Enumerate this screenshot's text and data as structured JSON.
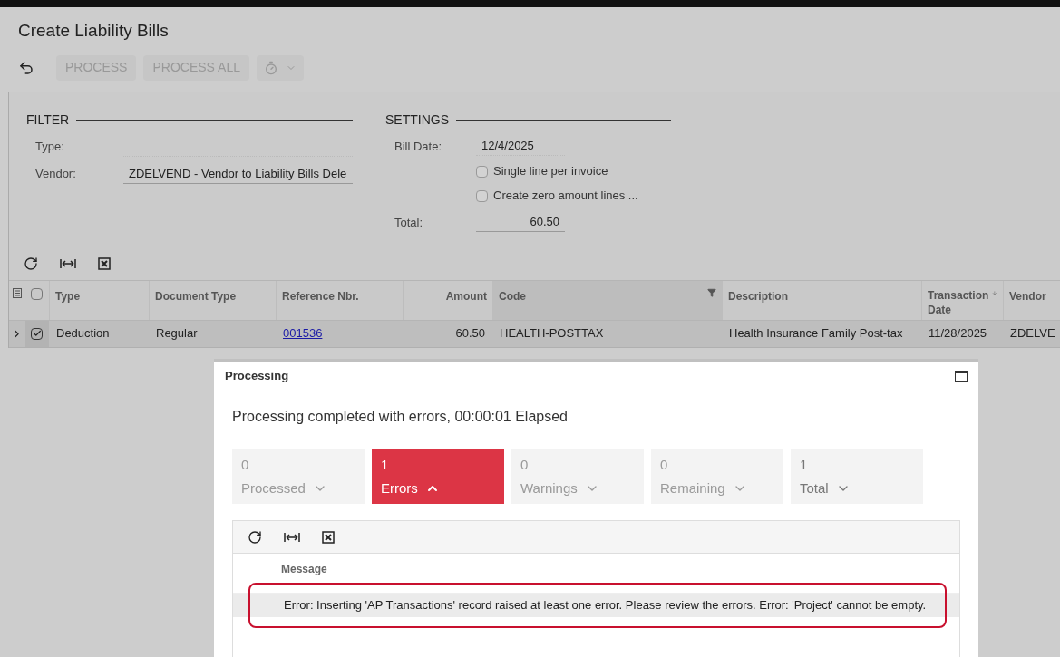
{
  "page": {
    "title": "Create Liability Bills"
  },
  "toolbar": {
    "buttons": [
      {
        "label": "PROCESS",
        "disabled": true
      },
      {
        "label": "PROCESS ALL",
        "disabled": true
      }
    ]
  },
  "filter": {
    "title": "FILTER",
    "fields": [
      {
        "label": "Type:"
      },
      {
        "label": "Vendor:",
        "value": "ZDELVEND - Vendor to Liability Bills Dele"
      }
    ]
  },
  "settings": {
    "title": "SETTINGS",
    "bill_date": {
      "label": "Bill Date:",
      "value": "12/4/2025"
    },
    "checkboxes": [
      {
        "label": "Single line per invoice",
        "checked": false
      },
      {
        "label": "Create zero amount lines ...",
        "checked": false
      }
    ],
    "total": {
      "label": "Total:",
      "value": "60.50"
    }
  },
  "grid": {
    "columns": [
      {
        "label": "Type",
        "kind": "text"
      },
      {
        "label": "Document Type",
        "kind": "text"
      },
      {
        "label": "Reference Nbr.",
        "kind": "link"
      },
      {
        "label": "Amount",
        "kind": "number"
      },
      {
        "label": "Code",
        "kind": "filtered"
      },
      {
        "label": "Description",
        "kind": "text"
      },
      {
        "label": "Transaction Date",
        "kind": "sorted"
      },
      {
        "label": "Vendor",
        "kind": "text"
      }
    ],
    "rows": [
      {
        "checked": true,
        "cells": [
          "Deduction",
          "Regular",
          "001536",
          "60.50",
          "HEALTH-POSTTAX",
          "Health Insurance Family Post-tax",
          "11/28/2025",
          "ZDELVE"
        ]
      }
    ],
    "all_checked": false
  },
  "dialog": {
    "title": "Processing",
    "status": "Processing completed with errors, 00:00:01 Elapsed",
    "tiles": [
      {
        "count": "0",
        "label": "Processed",
        "selected": false,
        "kind": "muted"
      },
      {
        "count": "1",
        "label": "Errors",
        "selected": true,
        "kind": "error"
      },
      {
        "count": "0",
        "label": "Warnings",
        "selected": false,
        "kind": "muted"
      },
      {
        "count": "0",
        "label": "Remaining",
        "selected": false,
        "kind": "muted"
      },
      {
        "count": "1",
        "label": "Total",
        "selected": false,
        "kind": "normal"
      }
    ],
    "grid": {
      "columns": [
        "Message"
      ],
      "rows": [
        {
          "message": "Error: Inserting 'AP Transactions' record raised at least one error. Please review the errors. Error: 'Project' cannot be empty.",
          "highlighted": true
        }
      ]
    }
  }
}
